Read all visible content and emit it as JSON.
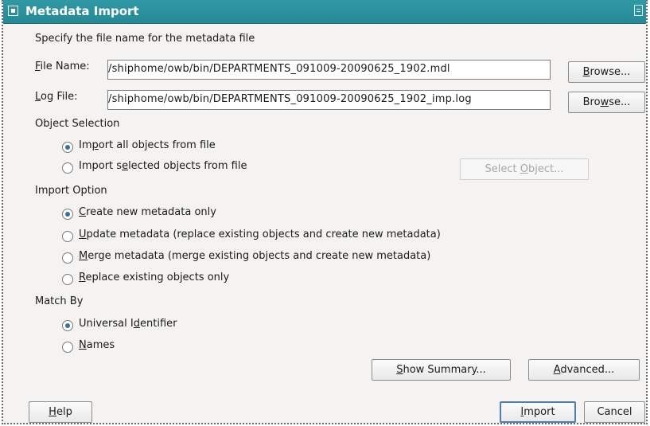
{
  "title": "Metadata Import",
  "instruction": "Specify the file name for the metadata file",
  "file_name": {
    "label_u": "F",
    "label_rest": "ile Name:",
    "value": "/shiphome/owb/bin/DEPARTMENTS_091009-20090625_1902.mdl",
    "browse_pre": "",
    "browse_u": "B",
    "browse_post": "rowse..."
  },
  "log_file": {
    "label_u": "L",
    "label_rest": "og File:",
    "value": "/shiphome/owb/bin/DEPARTMENTS_091009-20090625_1902_imp.log",
    "browse_pre": "Bro",
    "browse_u": "w",
    "browse_post": "se..."
  },
  "object_selection": {
    "heading": "Object Selection",
    "all_pre": "Im",
    "all_u": "p",
    "all_post": "ort all objects from file",
    "selected_pre": "Import s",
    "selected_u": "e",
    "selected_post": "lected objects from file",
    "select_object_pre": "Select ",
    "select_object_u": "O",
    "select_object_post": "bject...",
    "selected_option": "all"
  },
  "import_option": {
    "heading": "Import Option",
    "create_u": "C",
    "create_rest": "reate new metadata only",
    "update_u": "U",
    "update_rest": "pdate metadata (replace existing objects and create new metadata)",
    "merge_u": "M",
    "merge_rest": "erge metadata (merge existing objects and create new metadata)",
    "replace_u": "R",
    "replace_rest": "eplace existing objects only",
    "selected_option": "create"
  },
  "match_by": {
    "heading": "Match By",
    "universal_pre": "Universal I",
    "universal_u": "d",
    "universal_post": "entifier",
    "names_u": "N",
    "names_rest": "ames",
    "selected_option": "universal"
  },
  "buttons": {
    "show_summary_u": "S",
    "show_summary_rest": "how Summary...",
    "advanced_u": "A",
    "advanced_rest": "dvanced...",
    "help_u": "H",
    "help_rest": "elp",
    "import_u": "I",
    "import_rest": "mport",
    "cancel": "Cancel"
  },
  "colors": {
    "titlebar": "#2f99a6",
    "radio_selected": "#3b6ea5",
    "default_button_border": "#4c7fae"
  }
}
